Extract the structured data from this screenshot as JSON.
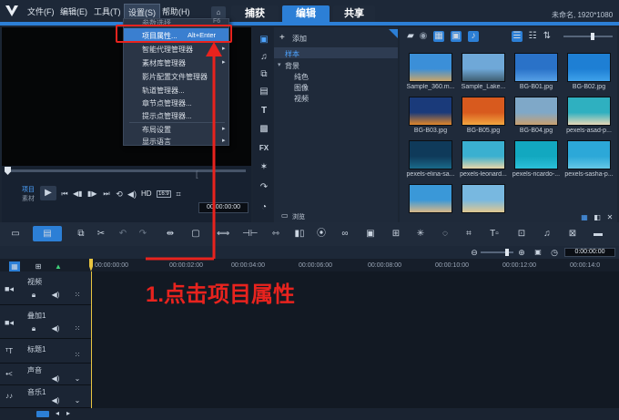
{
  "menu": {
    "file": "文件(F)",
    "edit": "编辑(E)",
    "tools": "工具(T)",
    "settings": "设置(S)",
    "help": "帮助(H)"
  },
  "tabs": {
    "capture": "捕获",
    "edit": "编辑",
    "share": "共享"
  },
  "project_info": "未命名, 1920*1080",
  "settings_menu": {
    "partial_first": "参数选择...",
    "partial_shortcut": "F6",
    "items": [
      "项目属性...",
      "智能代理管理器",
      "素材库管理器",
      "影片配置文件管理器",
      "轨道管理器...",
      "章节点管理器...",
      "提示点管理器...",
      "布局设置",
      "显示语言"
    ],
    "project_props_shortcut": "Alt+Enter"
  },
  "annotation": {
    "label": "1.点击项目属性",
    "color": "#e8231e"
  },
  "player": {
    "project_label": "项目",
    "clip_label": "素材",
    "hd_label": "HD",
    "aspect": "16:9",
    "timecode": "00:00:00:00"
  },
  "library": {
    "add_label": "添加",
    "tree": {
      "root": "样本",
      "group": "背景",
      "children": [
        "纯色",
        "图像",
        "视频"
      ]
    },
    "browse_label": "浏览",
    "thumbs": [
      {
        "name": "Sample_360.m...",
        "color1": "#3b8fd8",
        "color2": "#c9a56a"
      },
      {
        "name": "Sample_Lake...",
        "color1": "#6fa8d8",
        "color2": "#3f5f72"
      },
      {
        "name": "BG-B01.jpg",
        "color1": "#2a72c8",
        "color2": "#56a0e6"
      },
      {
        "name": "BG-B02.jpg",
        "color1": "#1e7fd4",
        "color2": "#3fa2ea"
      },
      {
        "name": "BG-B03.jpg",
        "color1": "#1a3a7a",
        "color2": "#e0862a"
      },
      {
        "name": "BG-B05.jpg",
        "color1": "#d85a1e",
        "color2": "#f2a640"
      },
      {
        "name": "BG-B04.jpg",
        "color1": "#7fa8c8",
        "color2": "#c8a070"
      },
      {
        "name": "pexels-asad-p...",
        "color1": "#2fb0c0",
        "color2": "#e6d8b8"
      },
      {
        "name": "pexels-elina-sa...",
        "color1": "#0f3a5a",
        "color2": "#1a6a8a"
      },
      {
        "name": "pexels-leonard...",
        "color1": "#3ab0d0",
        "color2": "#e8d6a8"
      },
      {
        "name": "pexels-ricardo-...",
        "color1": "#12a8c0",
        "color2": "#2cc0d8"
      },
      {
        "name": "pexels-sasha-p...",
        "color1": "#2ca8d8",
        "color2": "#64c8e6"
      },
      {
        "name": "",
        "color1": "#3a98d8",
        "color2": "#d8b888"
      },
      {
        "name": "",
        "color1": "#78b8e0",
        "color2": "#e0c890"
      }
    ]
  },
  "timeline": {
    "zoom_timecode": "0:00:00:00",
    "ruler": [
      "00:00:00:00",
      "00:00:02:00",
      "00:00:04:00",
      "00:00:06:00",
      "00:00:08:00",
      "00:00:10:00",
      "00:00:12:00",
      "00:00:14:0"
    ],
    "tracks": [
      {
        "name": "视频"
      },
      {
        "name": "叠加1"
      },
      {
        "name": "标题1"
      },
      {
        "name": "声音"
      },
      {
        "name": "音乐1"
      }
    ]
  },
  "colors": {
    "accent": "#2c7fd6",
    "highlight": "#e8231e"
  }
}
